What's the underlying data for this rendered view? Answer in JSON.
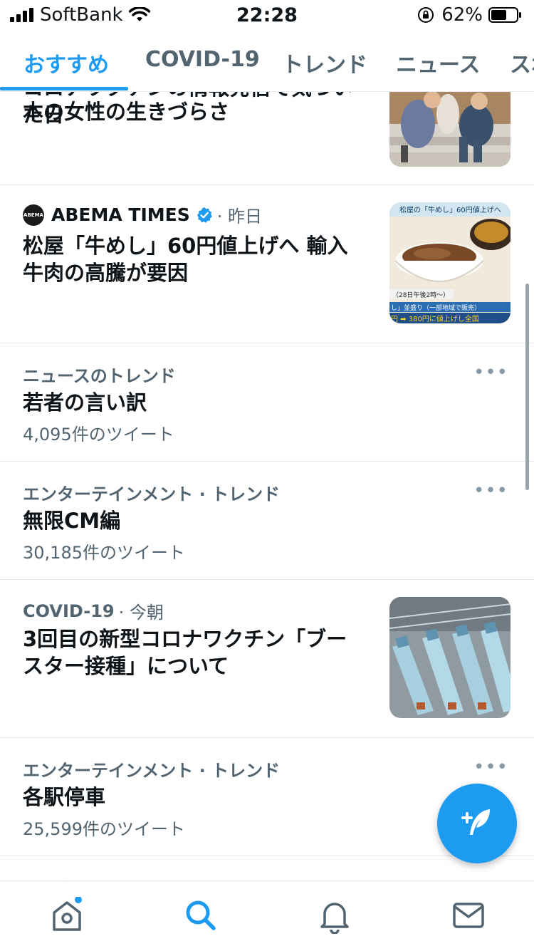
{
  "status_bar": {
    "carrier": "SoftBank",
    "time": "22:28",
    "battery_percent": "62%",
    "battery_level": 0.62
  },
  "tabs": [
    {
      "label": "おすすめ",
      "active": true
    },
    {
      "label": "COVID-19",
      "active": false
    },
    {
      "label": "トレンド",
      "active": false
    },
    {
      "label": "ニュース",
      "active": false
    },
    {
      "label": "スポ",
      "active": false
    }
  ],
  "feed": {
    "item0": {
      "headline_line1": "コロナワクチンの情報発信で気づいた日",
      "headline_line2": "本の女性の生きづらさ"
    },
    "item1": {
      "source": "ABEMA TIMES",
      "time": "· 昨日",
      "headline": "松屋「牛めし」60円値上げへ 輸入牛肉の高騰が要因",
      "thumb_text_top": "松屋の「牛めし」60円値上げへ",
      "thumb_text_mid": "（28日午後2時～）",
      "thumb_text_bot": "し」並盛り（一部地域で販売）",
      "thumb_text_price": "円 ➡ 380円に値上げし全国"
    },
    "trend1": {
      "category": "ニュースのトレンド",
      "title": "若者の言い訳",
      "count": "4,095件のツイート"
    },
    "trend2": {
      "category": "エンターテインメント · トレンド",
      "title": "無限CM編",
      "count": "30,185件のツイート"
    },
    "item2": {
      "source": "COVID-19",
      "time": "· 今朝",
      "headline": "3回目の新型コロナワクチン「ブースター接種」について"
    },
    "trend3": {
      "category": "エンターテインメント · トレンド",
      "title": "各駅停車",
      "count": "25,599件のツイート"
    },
    "trend4": {
      "category": "エンターテインメント · トレンド"
    },
    "more_label": "•••"
  },
  "icons": {
    "home": "home-icon",
    "search": "search-icon",
    "notifications": "bell-icon",
    "messages": "mail-icon",
    "compose": "compose-tweet-icon",
    "more": "more-dots-icon",
    "verified": "verified-badge-icon"
  },
  "colors": {
    "accent": "#1d9bf0",
    "text_primary": "#0f1419",
    "text_secondary": "#536471"
  }
}
